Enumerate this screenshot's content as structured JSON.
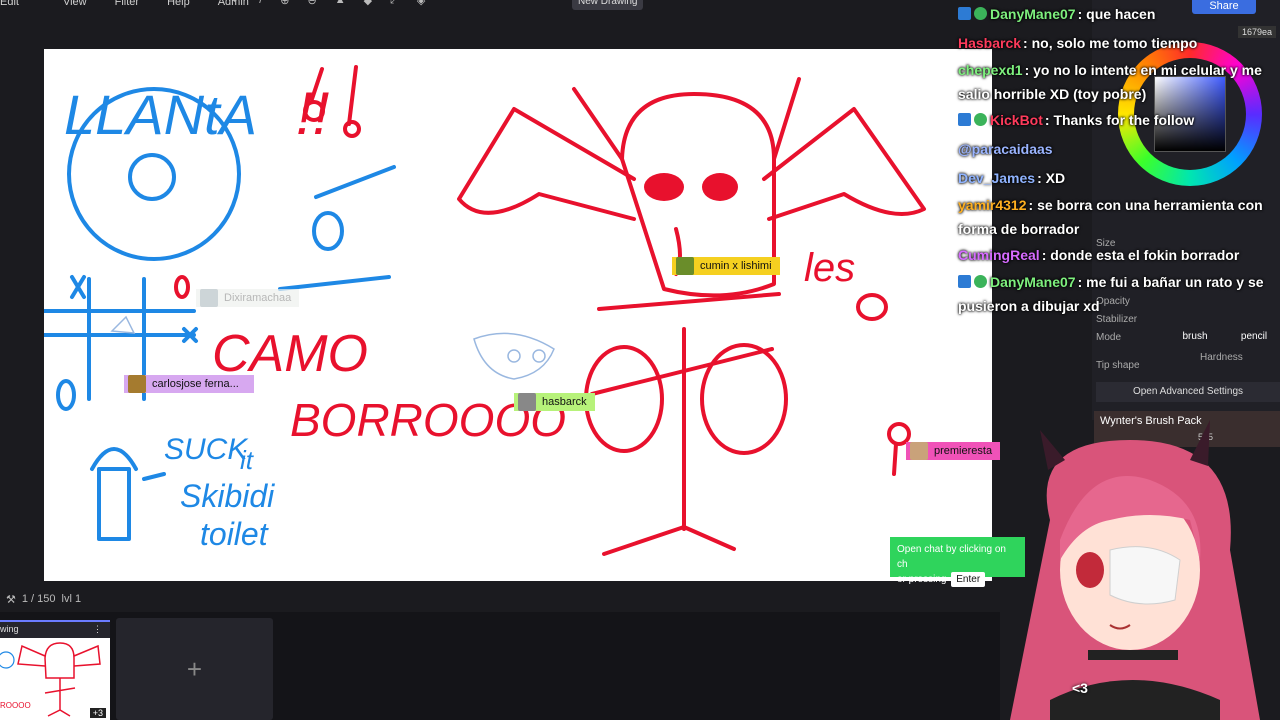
{
  "menu": [
    "Edit",
    "View",
    "Filter",
    "Help",
    "Admin"
  ],
  "toolbar": {
    "new_drawing": "New Drawing",
    "share": "Share",
    "size_readout": "1679ea"
  },
  "canvas": {
    "texts": {
      "llanta": "LLANtA",
      "bang": "!!",
      "como": "CAMO",
      "borrooo": "BORROOOO",
      "suck": "SUCK",
      "it": "it",
      "skibidi": "Skibidi",
      "toilet": "toilet",
      "les": "les",
      "o": "O"
    },
    "cursors": {
      "cumin": "cumin x lishimi",
      "hasbarck": "hasbarck",
      "premier": "premieresta",
      "carlos": "carlosjose ferna...",
      "dixira": "Dixiramachaa"
    },
    "hint": {
      "text_line1": "Open chat by clicking on ch",
      "text_line2": "or pressing",
      "key": "Enter"
    }
  },
  "status": {
    "page": "1 / 150",
    "level": "lvl 1"
  },
  "filmstrip": {
    "thumb_label": "wing",
    "thumb_badge": "+3",
    "add_label": "+"
  },
  "chat": [
    {
      "user": "DanyMane07",
      "color": "#7ef07e",
      "text": ": que hacen",
      "badges": 2
    },
    {
      "user": "Hasbarck",
      "color": "#ff3b5c",
      "text": ": no, solo me tomo tiempo",
      "badges": 0
    },
    {
      "user": "chepexd1",
      "color": "#7ef07e",
      "text": ": yo no lo intente en mi celular y me salio horrible XD (toy pobre)",
      "badges": 0
    },
    {
      "user": "KickBot",
      "color": "#ff3b5c",
      "text": ": Thanks for the follow",
      "badges": 2
    },
    {
      "user": "@paracaidaas",
      "color": "#9ab4ff",
      "text": "",
      "badges": 0
    },
    {
      "user": "Dev_James",
      "color": "#8fb3ff",
      "text": ": XD",
      "badges": 0
    },
    {
      "user": "yamir4312",
      "color": "#ffb020",
      "text": ": se borra con una herramienta con forma de borrador",
      "badges": 0
    },
    {
      "user": "CumingReal",
      "color": "#d66bff",
      "text": ": donde esta el fokin borrador",
      "badges": 0
    },
    {
      "user": "DanyMane07",
      "color": "#7ef07e",
      "text": ": me fui a bañar un rato y se pusieron a dibujar xd",
      "badges": 2
    }
  ],
  "panel": {
    "size_label": "Size",
    "opacity_label": "Opacity",
    "stabilizer_label": "Stabilizer",
    "mode_label": "Mode",
    "mode_brush": "brush",
    "mode_pencil": "pencil",
    "tip_label": "Tip shape",
    "hardness_label": "Hardness",
    "advanced": "Open Advanced Settings",
    "brushpack": "Wynter's Brush Pack",
    "brushpack_count": "525"
  },
  "overlay": {
    "heart": "<3"
  },
  "colors": {
    "accent": "#3a6de0",
    "ink_red": "#e8112d",
    "ink_blue": "#1e88e5"
  }
}
